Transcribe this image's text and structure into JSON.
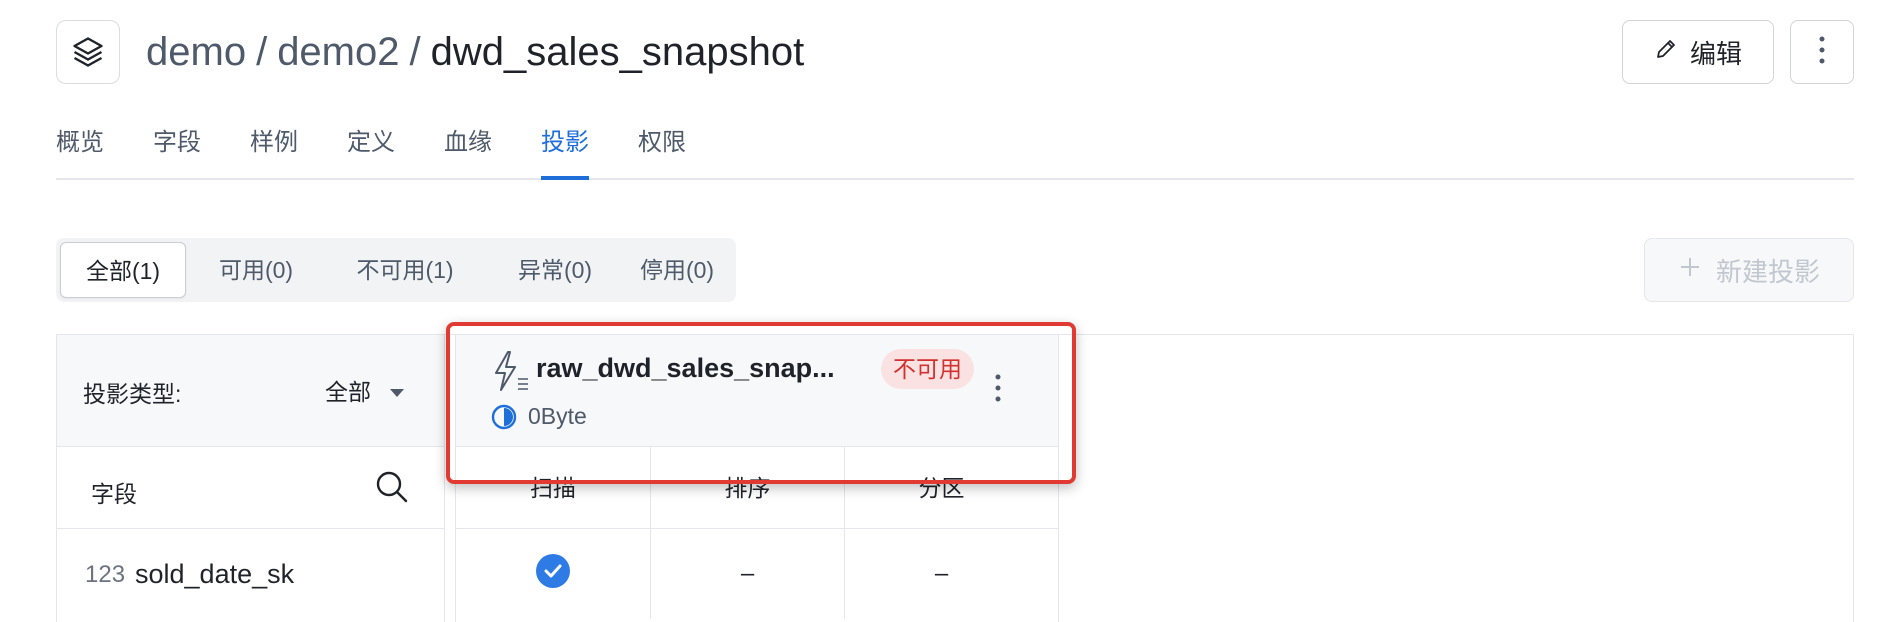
{
  "breadcrumb": {
    "part1": "demo",
    "sep": "/",
    "part2": "demo2",
    "current": "dwd_sales_snapshot"
  },
  "header": {
    "edit_label": "编辑",
    "logo_icon": "layers-icon",
    "edit_icon": "pencil-icon",
    "more_icon": "vertical-ellipsis-icon"
  },
  "tabs": [
    "概览",
    "字段",
    "样例",
    "定义",
    "血缘",
    "投影",
    "权限"
  ],
  "active_tab": "投影",
  "segments": [
    "全部(1)",
    "可用(0)",
    "不可用(1)",
    "异常(0)",
    "停用(0)"
  ],
  "active_segment": "全部(1)",
  "new_button": {
    "label": "新建投影",
    "icon": "plus-icon",
    "disabled": true
  },
  "filter": {
    "label": "投影类型:",
    "value": "全部"
  },
  "field_header": {
    "label": "字段",
    "icon": "search-icon"
  },
  "projection": {
    "name": "raw_dwd_sales_snap...",
    "status": "不可用",
    "size": "0Byte",
    "columns": [
      "扫描",
      "排序",
      "分区"
    ]
  },
  "rows": [
    {
      "type": "123",
      "name": "sold_date_sk",
      "scan": "check",
      "sort": "–",
      "partition": "–"
    }
  ],
  "colors": {
    "accent": "#1e6fd9",
    "danger": "#d0322f",
    "danger_bg": "#fbe2e2",
    "highlight": "#e03a32"
  }
}
